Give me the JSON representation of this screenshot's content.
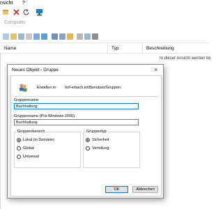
{
  "menubar": {
    "items": [
      "nsicht",
      "?"
    ]
  },
  "breadcrumb": "Computer",
  "columns": [
    "Name",
    "Typ",
    "Beschreibung"
  ],
  "empty_view_text": "In dieser Ansicht werden ke",
  "dialog": {
    "title": "Neues Objekt - Gruppe",
    "created_in_label": "Erstellen in:",
    "created_in_path": "hof-erbach.int/Benutzer/Gruppen",
    "group_name_label": "Gruppenname:",
    "group_name_value": "Buchhaltung",
    "group_name_pre2000_label": "Gruppenname (Prä-Windows 2000):",
    "group_name_pre2000_value": "Buchhaltung",
    "scope": {
      "title": "Gruppenbereich",
      "options": [
        "Lokal (in Domäne)",
        "Global",
        "Universal"
      ],
      "selected": "Lokal (in Domäne)"
    },
    "type": {
      "title": "Gruppentyp",
      "options": [
        "Sicherheit",
        "Verteilung"
      ],
      "selected": "Sicherheit"
    },
    "ok_label": "OK",
    "cancel_label": "Abbrechen"
  }
}
